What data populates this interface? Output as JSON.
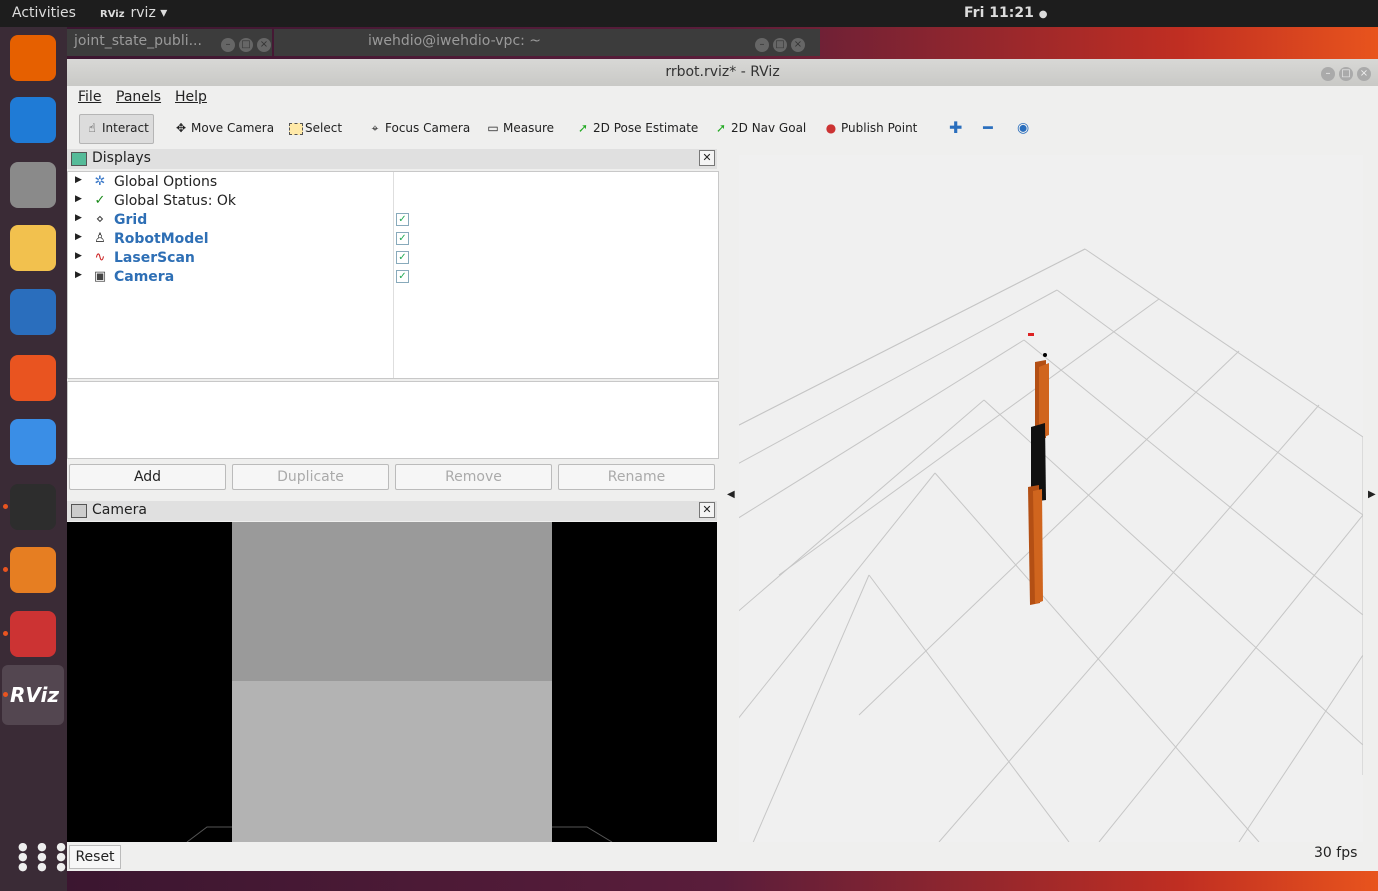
{
  "topbar": {
    "activities": "Activities",
    "app_name": "rviz",
    "app_logo": "RViz",
    "clock": "Fri 11:21"
  },
  "dock": {
    "items": [
      {
        "name": "firefox-icon",
        "color": "#e66000"
      },
      {
        "name": "thunderbird-icon",
        "color": "#1f7bd6"
      },
      {
        "name": "files-icon",
        "color": "#8a8a8a"
      },
      {
        "name": "rhythmbox-icon",
        "color": "#f2c14e"
      },
      {
        "name": "writer-icon",
        "color": "#2a6ebd"
      },
      {
        "name": "software-icon",
        "color": "#e95420"
      },
      {
        "name": "help-icon",
        "color": "#3a8ee6"
      },
      {
        "name": "terminal-icon",
        "color": "#2d2d2d"
      },
      {
        "name": "gazebo-icon",
        "color": "#e67e22"
      },
      {
        "name": "blocked-app-icon",
        "color": "#cc3333"
      },
      {
        "name": "rviz-icon",
        "color": "#666666"
      }
    ],
    "rviz_label": "RViz",
    "apps_grid_icon": "show-apps-icon"
  },
  "background_windows": [
    {
      "title": "joint_state_publi..."
    },
    {
      "title": "iwehdio@iwehdio-vpc: ~"
    }
  ],
  "window": {
    "title": "rrbot.rviz* - RViz",
    "menu": [
      "File",
      "Panels",
      "Help"
    ],
    "toolbar": [
      {
        "label": "Interact",
        "icon": "hand-icon",
        "active": true
      },
      {
        "label": "Move Camera",
        "icon": "move-camera-icon",
        "active": false
      },
      {
        "label": "Select",
        "icon": "select-icon",
        "active": false
      },
      {
        "label": "Focus Camera",
        "icon": "focus-icon",
        "active": false
      },
      {
        "label": "Measure",
        "icon": "ruler-icon",
        "active": false
      },
      {
        "label": "2D Pose Estimate",
        "icon": "pose-arrow-icon",
        "active": false
      },
      {
        "label": "2D Nav Goal",
        "icon": "nav-arrow-icon",
        "active": false
      },
      {
        "label": "Publish Point",
        "icon": "pin-icon",
        "active": false
      }
    ],
    "displays_panel": {
      "title": "Displays",
      "items": [
        {
          "label": "Global Options",
          "icon": "gear-icon",
          "checked": null,
          "highlight": false
        },
        {
          "label": "Global Status: Ok",
          "icon": "check-icon",
          "checked": null,
          "highlight": false
        },
        {
          "label": "Grid",
          "icon": "grid-icon",
          "checked": true,
          "highlight": true
        },
        {
          "label": "RobotModel",
          "icon": "robot-icon",
          "checked": true,
          "highlight": true
        },
        {
          "label": "LaserScan",
          "icon": "laser-icon",
          "checked": true,
          "highlight": true
        },
        {
          "label": "Camera",
          "icon": "camera-icon",
          "checked": true,
          "highlight": true
        }
      ],
      "buttons": {
        "add": "Add",
        "duplicate": "Duplicate",
        "remove": "Remove",
        "rename": "Rename"
      }
    },
    "camera_panel": {
      "title": "Camera"
    },
    "reset": "Reset",
    "fps": "30 fps"
  }
}
